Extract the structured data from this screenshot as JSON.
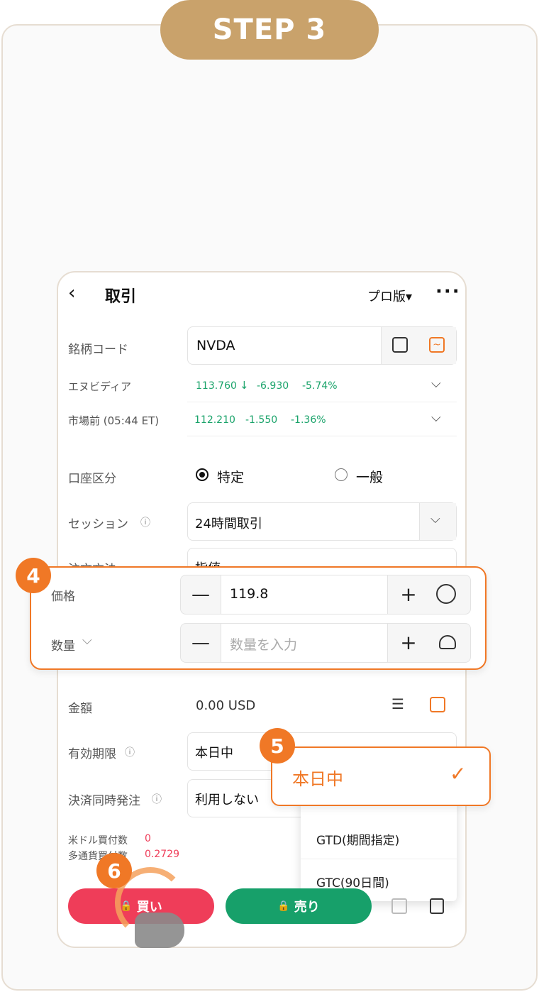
{
  "step_label": "STEP 3",
  "header": {
    "title": "取引",
    "pro_label": "プロ版▾"
  },
  "symbol": {
    "label": "銘柄コード",
    "value": "NVDA"
  },
  "quote": {
    "name": "エヌビディア",
    "price": "113.760",
    "change": "-6.930",
    "change_pct": "-5.74%",
    "premarket_label": "市場前 (05:44 ET)",
    "pre_price": "112.210",
    "pre_change": "-1.550",
    "pre_change_pct": "-1.36%"
  },
  "account": {
    "label": "口座区分",
    "option1": "特定",
    "option2": "一般"
  },
  "session": {
    "label": "セッション",
    "value": "24時間取引"
  },
  "order_method": {
    "label": "注文方法",
    "value": "指値"
  },
  "price": {
    "label": "価格",
    "value": "119.8"
  },
  "quantity": {
    "label": "数量",
    "placeholder": "数量を入力"
  },
  "amount": {
    "label": "金額",
    "value": "0.00 USD"
  },
  "validity": {
    "label": "有効期限",
    "value": "本日中"
  },
  "settle": {
    "label": "決済同時発注",
    "value": "利用しない"
  },
  "buying_power": {
    "usd_label": "米ドル買付数",
    "usd_value": "0",
    "multi_label": "多通貨買付数",
    "multi_value": "0.2729"
  },
  "dropdown": {
    "selected": "本日中",
    "options": [
      "GTD(期間指定)",
      "GTC(90日間)"
    ]
  },
  "buttons": {
    "buy": "買い",
    "sell": "売り"
  },
  "badges": {
    "b4": "4",
    "b5": "5",
    "b6": "6"
  },
  "colors": {
    "accent": "#f07826",
    "buy": "#ef3d59",
    "sell": "#17a06a",
    "gold": "#c9a26b"
  }
}
